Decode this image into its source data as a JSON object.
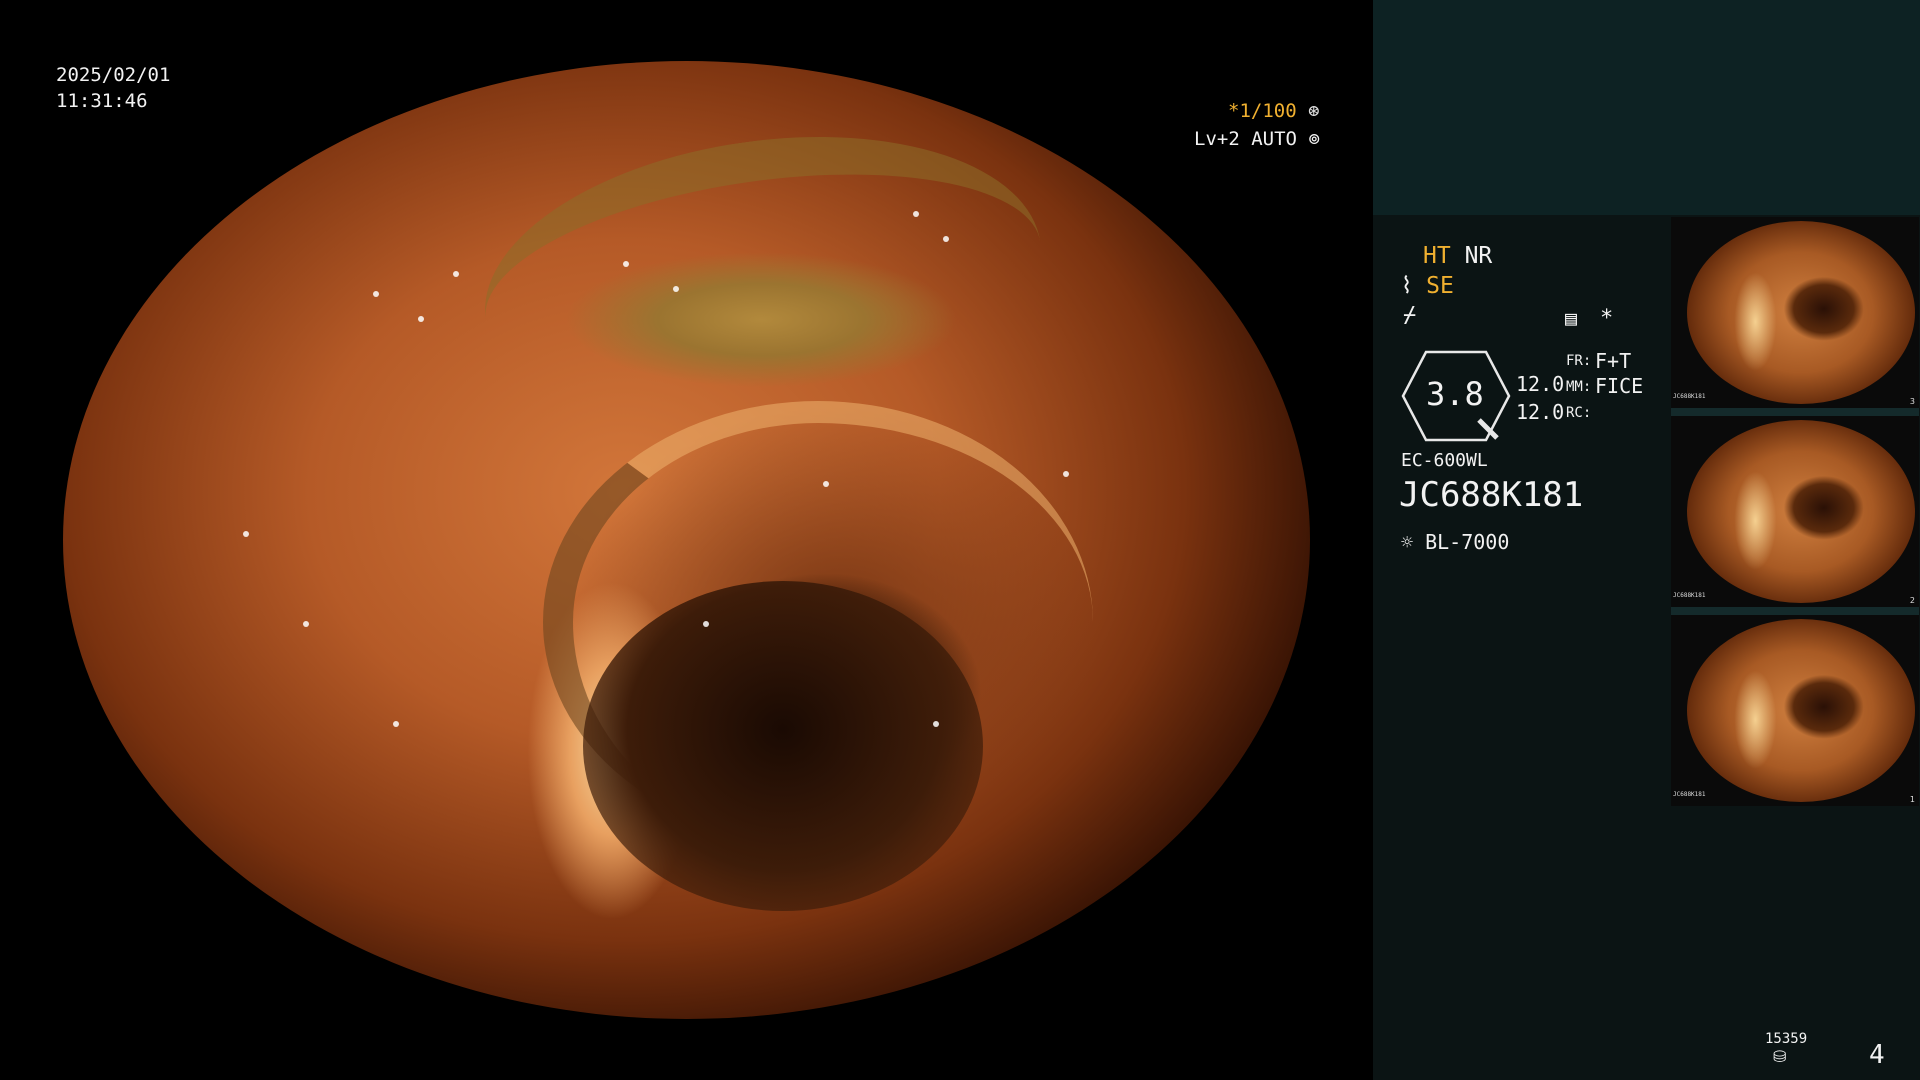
{
  "datetime": {
    "date": "2025/02/01",
    "time": "11:31:46"
  },
  "osd_top_right": {
    "shutter": "*1/100",
    "level": "Lv+2",
    "mode": "AUTO"
  },
  "settings": {
    "ht": "HT",
    "nr": "NR",
    "se": "SE",
    "zoom": "3.8",
    "values": [
      "12.0",
      "12.0"
    ],
    "labels": {
      "fr": "FR:",
      "mm": "MM:",
      "rc": "RC:"
    },
    "fr_value": "F+T",
    "mm_value": "FICE",
    "asterisk": "*"
  },
  "scope": {
    "model": "EC-600WL",
    "serial": "JC688K181",
    "light_source": "BL-7000"
  },
  "thumbnails": [
    {
      "number": "3",
      "label": "JC688K181"
    },
    {
      "number": "2",
      "label": "JC688K181"
    },
    {
      "number": "1",
      "label": "JC688K181"
    }
  ],
  "footer": {
    "counter": "15359",
    "page": "4"
  },
  "colors": {
    "accent_yellow": "#f0b030",
    "panel_bg": "#0b1414",
    "panel_top_bg": "#0d2223"
  }
}
